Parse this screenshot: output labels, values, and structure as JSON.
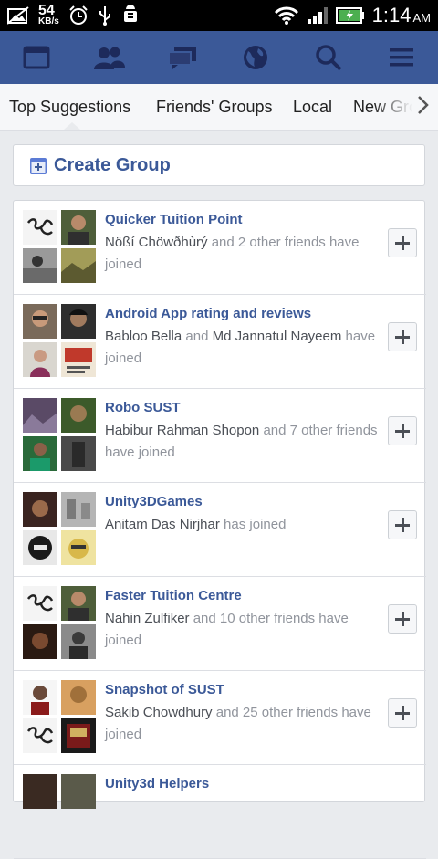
{
  "status_bar": {
    "net_speed": "54",
    "net_unit": "KB/s",
    "time": "1:14",
    "ampm": "AM",
    "icons": [
      "image-icon",
      "alarm-icon",
      "usb-icon",
      "android-debug-icon",
      "wifi-icon",
      "signal-icon",
      "battery-icon"
    ]
  },
  "nav": {
    "items": [
      {
        "name": "news-feed-icon"
      },
      {
        "name": "friends-icon"
      },
      {
        "name": "messages-icon"
      },
      {
        "name": "globe-icon"
      },
      {
        "name": "search-icon"
      },
      {
        "name": "menu-icon"
      }
    ]
  },
  "tabs": [
    {
      "label": "Top Suggestions"
    },
    {
      "label": "Friends' Groups"
    },
    {
      "label": "Local"
    },
    {
      "label": "New Gro"
    }
  ],
  "create_group": {
    "label": "Create Group"
  },
  "groups": [
    {
      "name": "Quicker Tuition Point",
      "who": "Nößí Chöwðhùrý",
      "rest": " and 2 other friends have joined"
    },
    {
      "name": "Android App rating and reviews",
      "who": "Babloo Bella",
      "rest": " and ",
      "who2": "Md Jannatul Nayeem",
      "rest2": " have joined"
    },
    {
      "name": "Robo SUST",
      "who": "Habibur Rahman Shopon",
      "rest": " and 7 other friends have joined"
    },
    {
      "name": "Unity3DGames",
      "who": "Anitam Das Nirjhar",
      "rest": " has joined"
    },
    {
      "name": "Faster Tuition Centre",
      "who": "Nahin Zulfiker",
      "rest": " and 10 other friends have joined"
    },
    {
      "name": "Snapshot of SUST",
      "who": "Sakib Chowdhury",
      "rest": " and 25 other friends have joined"
    },
    {
      "name": "Unity3d Helpers",
      "who": "",
      "rest": ""
    }
  ],
  "colors": {
    "brand": "#3b5998",
    "link": "#3b5998",
    "meta": "#90949c"
  }
}
